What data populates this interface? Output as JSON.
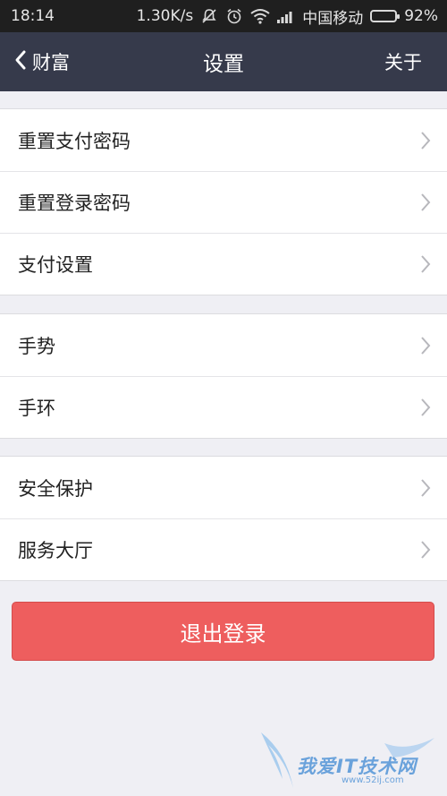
{
  "status_bar": {
    "time": "18:14",
    "speed": "1.30K/s",
    "carrier": "中国移动",
    "battery_percent": "92%",
    "battery_level": 0.92,
    "icons": [
      "mute-icon",
      "alarm-icon",
      "wifi-icon",
      "signal-icon",
      "battery-icon"
    ]
  },
  "nav": {
    "back_label": "财富",
    "title": "设置",
    "about_label": "关于"
  },
  "groups": [
    {
      "items": [
        {
          "label": "重置支付密码"
        },
        {
          "label": "重置登录密码"
        },
        {
          "label": "支付设置"
        }
      ]
    },
    {
      "items": [
        {
          "label": "手势"
        },
        {
          "label": "手环"
        }
      ]
    },
    {
      "items": [
        {
          "label": "安全保护"
        },
        {
          "label": "服务大厅"
        }
      ]
    }
  ],
  "logout_label": "退出登录",
  "watermark": {
    "text": "我爱IT技术网",
    "url": "www.52ij.com"
  },
  "colors": {
    "nav_bg": "#363a4b",
    "logout_bg": "#ee5e5e",
    "page_bg": "#efeff4",
    "battery": "#67d23b"
  }
}
